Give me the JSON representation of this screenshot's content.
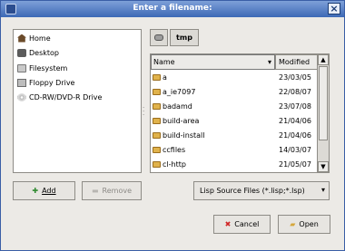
{
  "window": {
    "title": "Enter a filename:"
  },
  "places": [
    {
      "label": "Home",
      "icon": "home-icon"
    },
    {
      "label": "Desktop",
      "icon": "desktop-icon"
    },
    {
      "label": "Filesystem",
      "icon": "filesystem-icon"
    },
    {
      "label": "Floppy Drive",
      "icon": "floppy-icon"
    },
    {
      "label": "CD-RW/DVD-R Drive",
      "icon": "cd-icon"
    }
  ],
  "pathbar": {
    "current": "tmp"
  },
  "filelist": {
    "columns": {
      "name": "Name",
      "modified": "Modified"
    },
    "rows": [
      {
        "name": "a",
        "modified": "23/03/05"
      },
      {
        "name": "a_ie7097",
        "modified": "22/08/07"
      },
      {
        "name": "badamd",
        "modified": "23/07/08"
      },
      {
        "name": "build-area",
        "modified": "21/04/06"
      },
      {
        "name": "build-install",
        "modified": "21/04/06"
      },
      {
        "name": "ccfiles",
        "modified": "14/03/07"
      },
      {
        "name": "cl-http",
        "modified": "21/05/07"
      }
    ]
  },
  "buttons": {
    "add": "Add",
    "remove": "Remove",
    "cancel": "Cancel",
    "open": "Open"
  },
  "filter": {
    "selected": "Lisp Source Files (*.lisp;*.lsp)"
  }
}
